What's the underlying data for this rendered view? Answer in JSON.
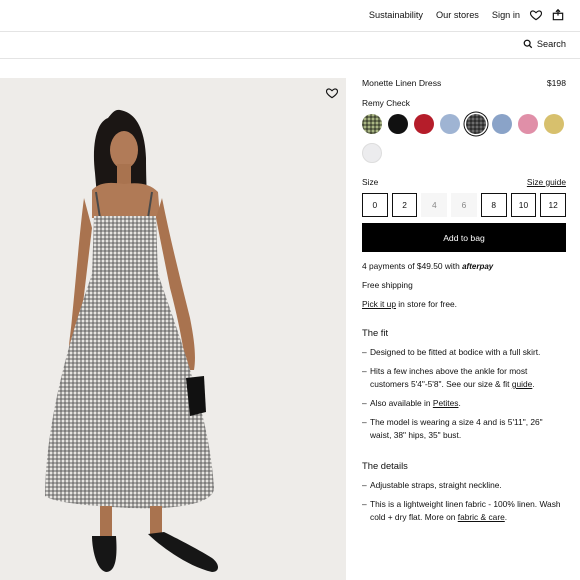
{
  "nav": {
    "links": [
      "Sustainability",
      "Our stores",
      "Sign in"
    ],
    "search_label": "Search"
  },
  "product": {
    "name": "Monette Linen Dress",
    "price": "$198",
    "color_name": "Remy Check",
    "swatches": [
      {
        "name": "green-check-swatch",
        "color": "#a9b683"
      },
      {
        "name": "black-swatch",
        "color": "#111111"
      },
      {
        "name": "red-swatch",
        "color": "#b51d2a"
      },
      {
        "name": "blue-floral-swatch",
        "color": "#9fb4d3"
      },
      {
        "name": "remy-check-swatch",
        "color": "#6c6c6c",
        "selected": true
      },
      {
        "name": "blue-print-swatch",
        "color": "#8aa3c8"
      },
      {
        "name": "pink-floral-swatch",
        "color": "#e08fa8"
      },
      {
        "name": "yellow-swatch",
        "color": "#d7c06d"
      },
      {
        "name": "white-swatch",
        "color": "#ececee"
      }
    ]
  },
  "size": {
    "label": "Size",
    "guide_label": "Size guide",
    "options": [
      {
        "label": "0",
        "available": true
      },
      {
        "label": "2",
        "available": true
      },
      {
        "label": "4",
        "available": false
      },
      {
        "label": "6",
        "available": false
      },
      {
        "label": "8",
        "available": true
      },
      {
        "label": "10",
        "available": true
      },
      {
        "label": "12",
        "available": true
      }
    ]
  },
  "cta": {
    "add_to_bag": "Add to bag"
  },
  "payment": {
    "text": "4 payments of $49.50 with",
    "brand": "afterpay"
  },
  "shipping": {
    "text": "Free shipping"
  },
  "pickup": {
    "link": "Pick it up",
    "rest": " in store for free."
  },
  "fit": {
    "title": "The fit",
    "b1": "Designed to be fitted at bodice with a full skirt.",
    "b2_pre": "Hits a few inches above the ankle for most customers 5'4\"-5'8\". See our size & fit ",
    "b2_link": "guide",
    "b2_post": ".",
    "b3_pre": "Also available in ",
    "b3_link": "Petites",
    "b3_post": ".",
    "b4": "The model is wearing a size 4 and is 5'11\", 26\" waist, 38\" hips, 35\" bust."
  },
  "details": {
    "title": "The details",
    "b1": "Adjustable straps, straight neckline.",
    "b2_pre": "This is a lightweight linen fabric - 100% linen. Wash cold + dry flat. More on ",
    "b2_link": "fabric & care",
    "b2_post": "."
  },
  "bullet": "–"
}
